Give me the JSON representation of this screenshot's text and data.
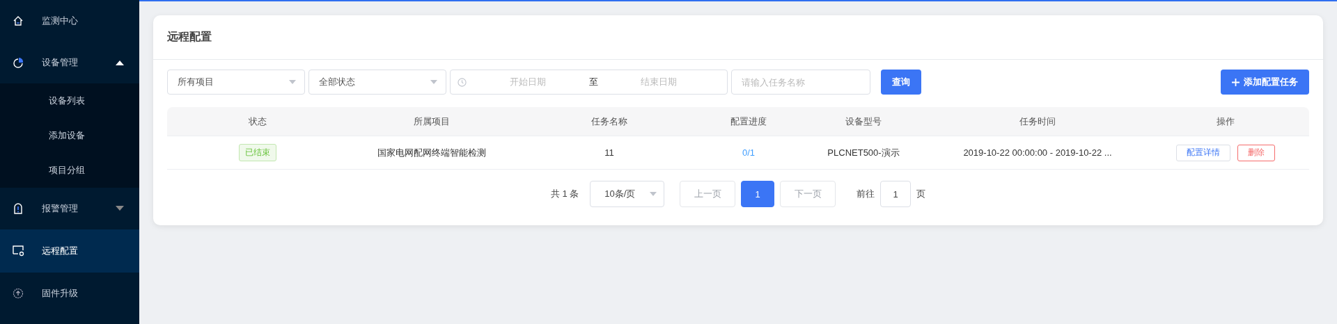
{
  "sidebar": {
    "items": [
      {
        "label": "监测中心",
        "selected": false
      },
      {
        "label": "设备管理",
        "selected": false,
        "expanded": true,
        "children": [
          {
            "label": "设备列表",
            "selected": false
          },
          {
            "label": "添加设备",
            "selected": false
          },
          {
            "label": "项目分组",
            "selected": false
          }
        ]
      },
      {
        "label": "报警管理",
        "selected": false,
        "expanded": false
      },
      {
        "label": "远程配置",
        "selected": true
      },
      {
        "label": "固件升级",
        "selected": false
      }
    ]
  },
  "card": {
    "title": "远程配置",
    "filters": {
      "project_select": {
        "value": "所有项目"
      },
      "status_select": {
        "value": "全部状态"
      },
      "date_range": {
        "start_placeholder": "开始日期",
        "separator": "至",
        "end_placeholder": "结束日期"
      },
      "task_name": {
        "placeholder": "请输入任务名称"
      },
      "query_button": "查询",
      "add_button": "添加配置任务"
    },
    "table": {
      "columns": [
        "状态",
        "所属项目",
        "任务名称",
        "配置进度",
        "设备型号",
        "任务时间",
        "操作"
      ],
      "rows": [
        {
          "status": {
            "label": "已结束",
            "kind": "ended"
          },
          "project": "国家电网配网终端智能检测",
          "task_name": "11",
          "progress": "0/1",
          "device_model": "PLCNET500-演示",
          "task_time": "2019-10-22 00:00:00 - 2019-10-22 ...",
          "actions": [
            {
              "label": "配置详情",
              "kind": "detail"
            },
            {
              "label": "删除",
              "kind": "delete"
            }
          ]
        }
      ]
    },
    "pagination": {
      "total": "共 1 条",
      "page_size": "10条/页",
      "prev": {
        "label": "上一页",
        "disabled": true
      },
      "pages": [
        {
          "label": "1",
          "selected": true
        }
      ],
      "next": {
        "label": "下一页",
        "disabled": true
      },
      "goto_label": "前往",
      "goto_value": "1",
      "goto_suffix": "页"
    }
  }
}
